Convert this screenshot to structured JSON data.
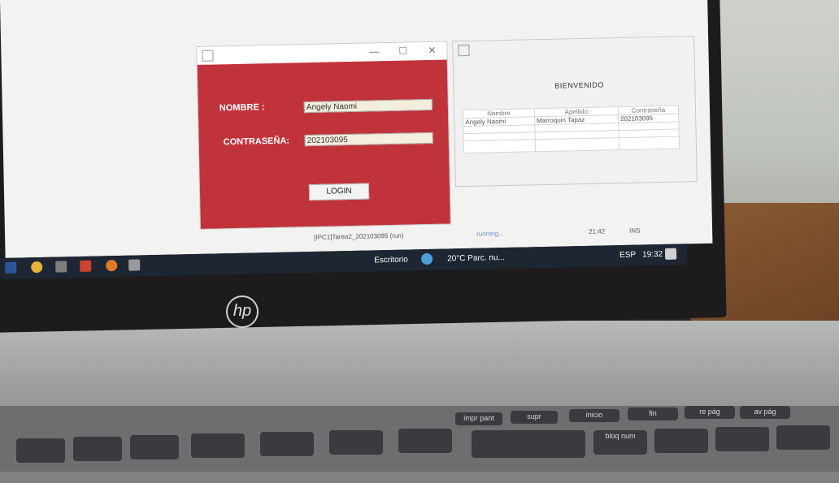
{
  "login_window": {
    "nombre_label": "NOMBRE :",
    "nombre_value": "Angely Naomi",
    "contrasena_label": "CONTRASEÑA:",
    "contrasena_value": "202103095",
    "login_button": "LOGIN",
    "title_controls": [
      "—",
      "☐",
      "✕"
    ]
  },
  "welcome_window": {
    "heading": "BIENVENIDO",
    "table": {
      "headers": [
        "Nombre",
        "Apellido",
        "Contraseña"
      ],
      "rows": [
        [
          "Angely Naomi",
          "Marroquin Tapaz",
          "202103095"
        ]
      ]
    }
  },
  "ide_status": {
    "project": "[IPC1]Tarea2_202103095 (run)",
    "state": "running...",
    "position": "21:42",
    "mode": "INS"
  },
  "taskbar": {
    "escritorio": "Escritorio",
    "weather": "20°C  Parc. nu...",
    "lang": "ESP",
    "time": "19:32"
  },
  "laptop": {
    "logo": "hp",
    "keys": [
      "impr pant",
      "supr",
      "inicio",
      "fin",
      "re pág",
      "av pág",
      "bloq num"
    ]
  },
  "colors": {
    "login_background": "#c0333a",
    "taskbar": "#1e2633"
  }
}
